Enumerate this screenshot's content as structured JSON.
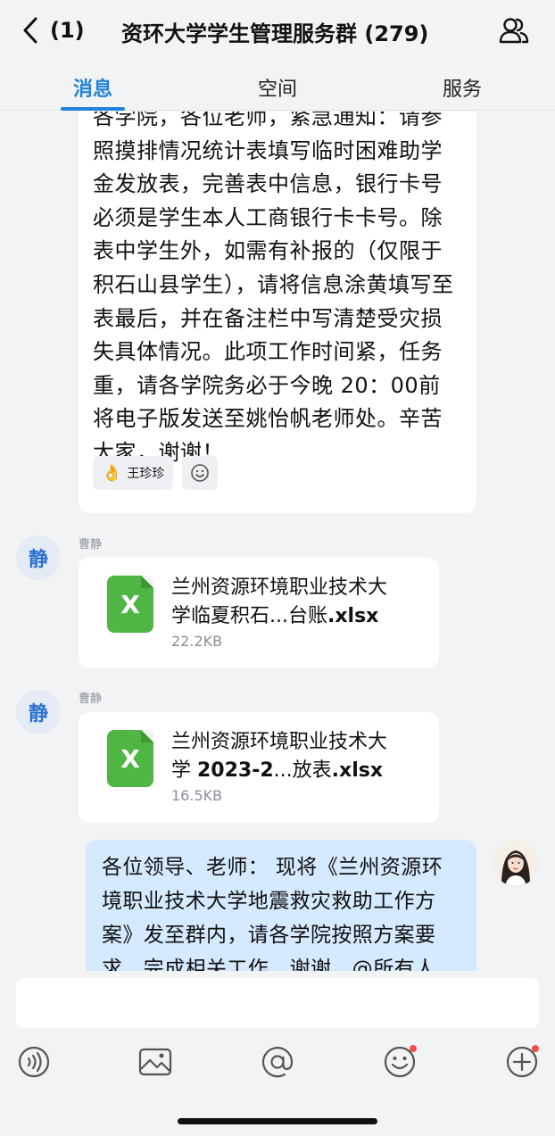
{
  "header": {
    "back_count": "(1)",
    "title": "资环大学学生管理服务群 (279)"
  },
  "tabs": [
    {
      "label": "消息",
      "active": true
    },
    {
      "label": "空间",
      "active": false
    },
    {
      "label": "服务",
      "active": false
    }
  ],
  "messages": {
    "notice": {
      "text": "各学院，各位老师，紧急通知：请参照摸排情况统计表填写临时困难助学金发放表，完善表中信息，银行卡号必须是学生本人工商银行卡卡号。除表中学生外，如需有补报的（仅限于积石山县学生），请将信息涂黄填写至表最后，并在备注栏中写清楚受灾损失具体情况。此项工作时间紧，任务重，请各学院务必于今晚 20：00前将电子版发送至姚怡帆老师处。辛苦大家，谢谢！",
      "reaction_emoji": "👌",
      "reaction_name": "王珍珍"
    },
    "file1": {
      "avatar_text": "静",
      "sender": "曹静",
      "icon_letter": "X",
      "name_line1": "兰州资源环境职业技术大",
      "name_line2_pre": "学临夏积石...台账",
      "name_line2_ext": ".xlsx",
      "size": "22.2KB"
    },
    "file2": {
      "avatar_text": "静",
      "sender": "曹静",
      "icon_letter": "X",
      "name_line1": "兰州资源环境职业技术大",
      "name_line2_pre": "学 ",
      "name_line2_bold": "2023-2",
      "name_line2_mid": "...放表",
      "name_line2_ext": ".xlsx",
      "size": "16.5KB"
    },
    "self_msg": {
      "text": "各位领导、老师： 现将《兰州资源环境职业技术大学地震救灾救助工作方案》发至群内，请各学院按照方案要求，完成相关工作，谢谢。@所有人"
    }
  },
  "toolbar": {
    "icons": [
      "voice-icon",
      "image-icon",
      "at-icon",
      "emoji-icon",
      "plus-icon"
    ]
  },
  "colors": {
    "accent": "#1f84d9",
    "self_bubble": "#d5e9ff",
    "excel_green": "#4fb543"
  }
}
